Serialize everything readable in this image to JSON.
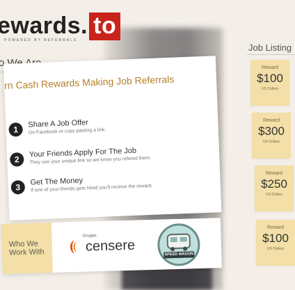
{
  "header": {
    "logo_main": "ewards.",
    "logo_box": "to",
    "tagline": "POWERED BY REFERRALS"
  },
  "section": {
    "who_we_are": "o We Are"
  },
  "card": {
    "title": "rn Cash Rewards Making Job Referrals",
    "steps": [
      {
        "num": "1",
        "head": "Share A Job Offer",
        "sub": "On Facebook or copy pasting a link."
      },
      {
        "num": "2",
        "head": "Your Friends Apply For The Job",
        "sub": "They use your unique link so we know you refered them."
      },
      {
        "num": "3",
        "head": "Get The Money",
        "sub": "If one of your friends gets hired you'll receive the reward."
      }
    ]
  },
  "partners": {
    "label_line1": "Who We",
    "label_line2": "Work With",
    "censere_small": "Gruppo",
    "censere_name": "censere",
    "speedwagon_text": "SPEED WAGON"
  },
  "job_listings": {
    "title": "Job Listing",
    "items": [
      {
        "label": "Reward",
        "amount": "$100",
        "currency": "US Dollars"
      },
      {
        "label": "Reward",
        "amount": "$300",
        "currency": "US Dollars"
      },
      {
        "label": "Reward",
        "amount": "$250",
        "currency": "US Dollars"
      },
      {
        "label": "Reward",
        "amount": "$100",
        "currency": "US Dollars"
      }
    ]
  },
  "colors": {
    "brand_red": "#c8241b",
    "accent_yellow": "#f3dfa7",
    "title_gold": "#b5802a"
  }
}
